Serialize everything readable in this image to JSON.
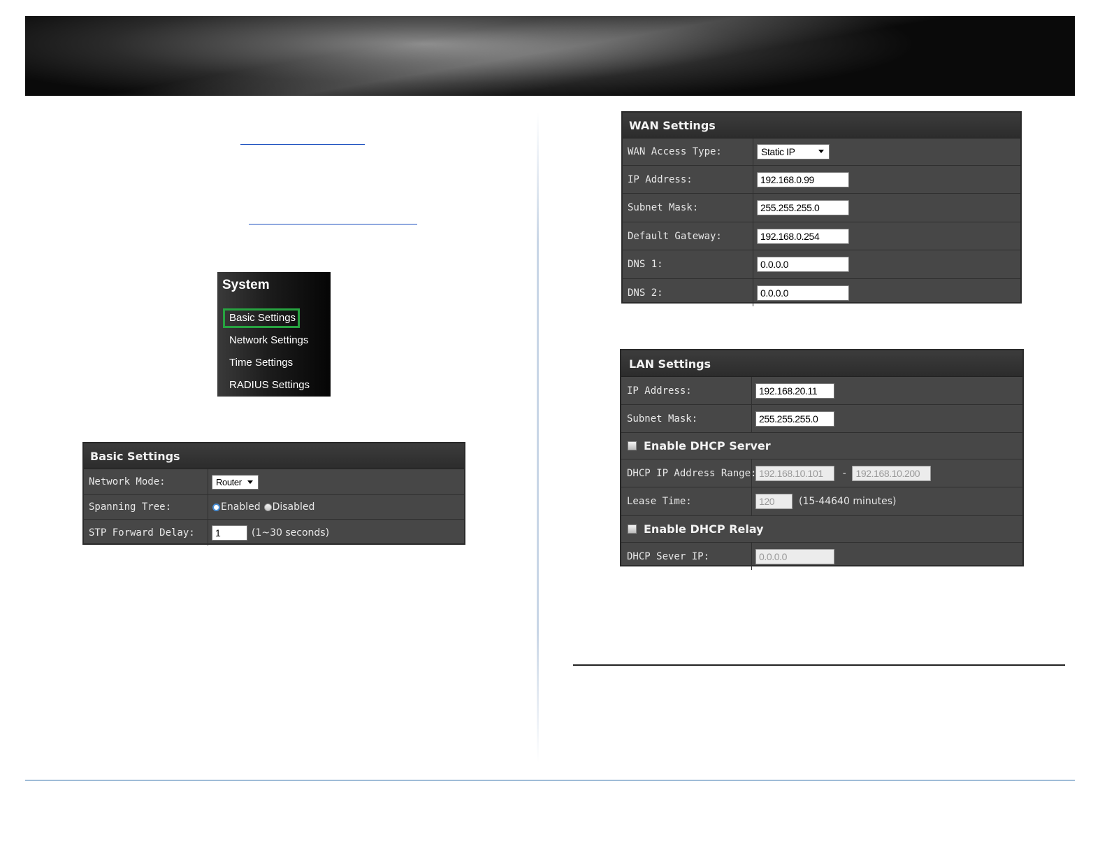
{
  "system_menu": {
    "title": "System",
    "items": [
      {
        "label": "Basic Settings",
        "selected": true
      },
      {
        "label": "Network Settings"
      },
      {
        "label": "Time Settings"
      },
      {
        "label": "RADIUS Settings"
      }
    ],
    "highlight_color": "#27a340"
  },
  "basic_settings": {
    "title": "Basic Settings",
    "network_mode": {
      "label": "Network Mode:",
      "value": "Router"
    },
    "spanning_tree": {
      "label": "Spanning Tree:",
      "opt_enabled": "Enabled",
      "opt_disabled": "Disabled",
      "selected": "Enabled"
    },
    "stp_forward_delay": {
      "label": "STP Forward Delay:",
      "value": "1",
      "hint": "(1~30 seconds)"
    }
  },
  "wan_settings": {
    "title": "WAN Settings",
    "access_type": {
      "label": "WAN Access Type:",
      "value": "Static IP"
    },
    "ip_address": {
      "label": "IP Address:",
      "value": "192.168.0.99"
    },
    "subnet_mask": {
      "label": "Subnet Mask:",
      "value": "255.255.255.0"
    },
    "default_gateway": {
      "label": "Default Gateway:",
      "value": "192.168.0.254"
    },
    "dns1": {
      "label": "DNS 1:",
      "value": "0.0.0.0"
    },
    "dns2": {
      "label": "DNS 2:",
      "value": "0.0.0.0"
    }
  },
  "lan_settings": {
    "title": "LAN Settings",
    "ip_address": {
      "label": "IP Address:",
      "value": "192.168.20.11"
    },
    "subnet_mask": {
      "label": "Subnet Mask:",
      "value": "255.255.255.0"
    },
    "enable_dhcp_server": {
      "label": "Enable DHCP Server",
      "checked": false
    },
    "dhcp_range": {
      "label": "DHCP IP Address Range:",
      "start": "192.168.10.101",
      "separator": "-",
      "end": "192.168.10.200"
    },
    "lease_time": {
      "label": "Lease Time:",
      "value": "120",
      "hint": "(15-44640 minutes)"
    },
    "enable_dhcp_relay": {
      "label": "Enable DHCP Relay",
      "checked": false
    },
    "dhcp_server_ip": {
      "label": "DHCP Sever IP:",
      "value": "0.0.0.0"
    }
  }
}
